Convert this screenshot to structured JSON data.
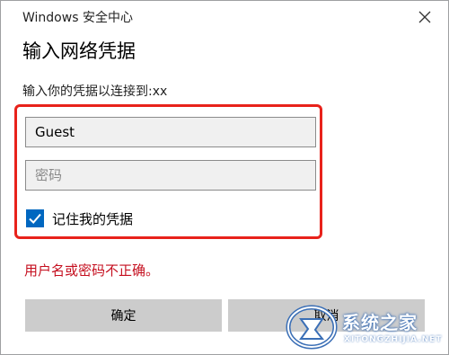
{
  "window": {
    "title": "Windows 安全中心"
  },
  "dialog": {
    "heading": "输入网络凭据",
    "subtitle": "输入你的凭据以连接到:xx"
  },
  "form": {
    "username_value": "Guest",
    "password_placeholder": "密码",
    "remember_label": "记住我的凭据",
    "remember_checked": true
  },
  "error_message": "用户名或密码不正确。",
  "buttons": {
    "ok_label": "确定",
    "cancel_label": "取消"
  },
  "watermark": {
    "text": "系统之家",
    "subtext": "XITONGZHIJIA.NET"
  },
  "colors": {
    "highlight": "#e8221b",
    "checkbox": "#0067c0",
    "error": "#c50f1f",
    "button": "#cccccc"
  }
}
